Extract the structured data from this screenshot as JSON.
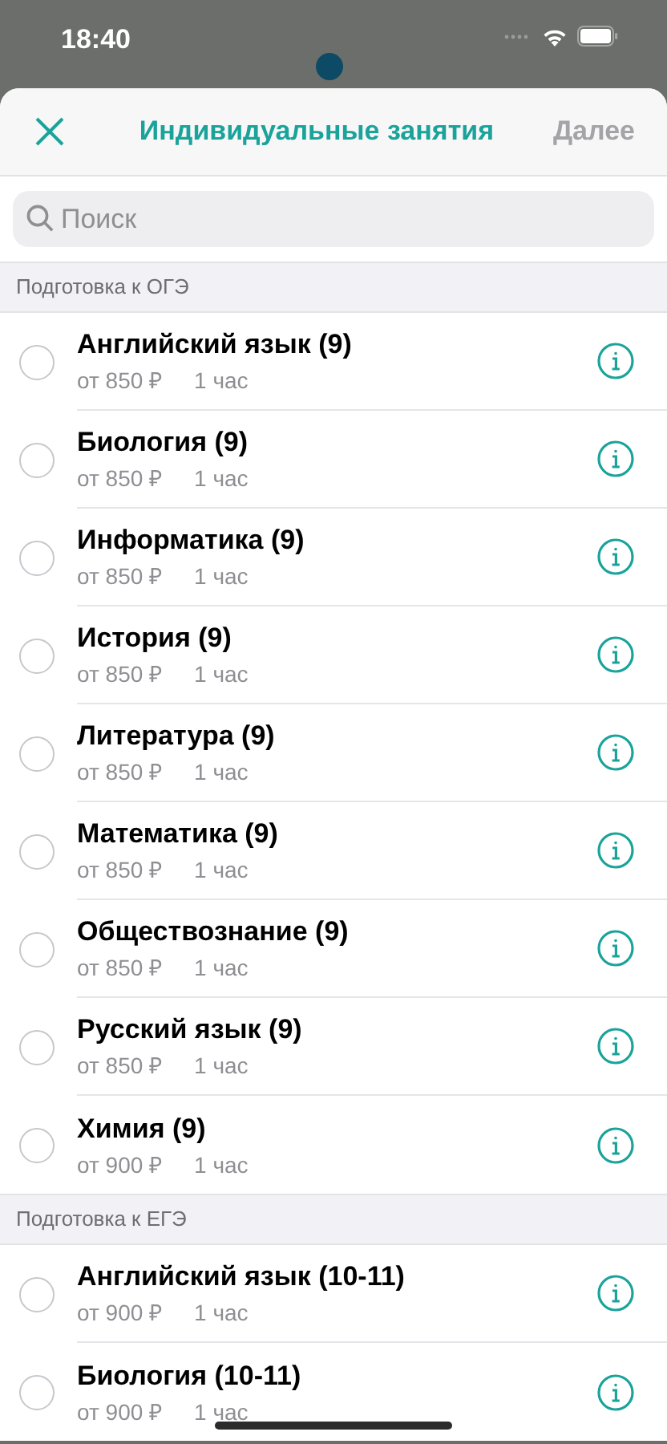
{
  "status_bar": {
    "time": "18:40"
  },
  "header": {
    "title": "Индивидуальные занятия",
    "next": {
      "label": "Далее",
      "disabled": true
    }
  },
  "search": {
    "placeholder": "Поиск"
  },
  "sections": [
    {
      "title": "Подготовка к ОГЭ",
      "items": [
        {
          "name": "Английский язык (9)",
          "price": "от 850 ₽",
          "duration": "1 час",
          "selected": false
        },
        {
          "name": "Биология (9)",
          "price": "от 850 ₽",
          "duration": "1 час",
          "selected": false
        },
        {
          "name": "Информатика (9)",
          "price": "от 850 ₽",
          "duration": "1 час",
          "selected": false
        },
        {
          "name": "История (9)",
          "price": "от 850 ₽",
          "duration": "1 час",
          "selected": false
        },
        {
          "name": "Литература (9)",
          "price": "от 850 ₽",
          "duration": "1 час",
          "selected": false
        },
        {
          "name": "Математика (9)",
          "price": "от 850 ₽",
          "duration": "1 час",
          "selected": false
        },
        {
          "name": "Обществознание (9)",
          "price": "от 850 ₽",
          "duration": "1 час",
          "selected": false
        },
        {
          "name": "Русский язык (9)",
          "price": "от 850 ₽",
          "duration": "1 час",
          "selected": false
        },
        {
          "name": "Химия (9)",
          "price": "от 900 ₽",
          "duration": "1 час",
          "selected": false
        }
      ]
    },
    {
      "title": "Подготовка к ЕГЭ",
      "items": [
        {
          "name": "Английский язык (10-11)",
          "price": "от 900 ₽",
          "duration": "1 час",
          "selected": false
        },
        {
          "name": "Биология (10-11)",
          "price": "от 900 ₽",
          "duration": "1 час",
          "selected": false
        }
      ]
    }
  ]
}
